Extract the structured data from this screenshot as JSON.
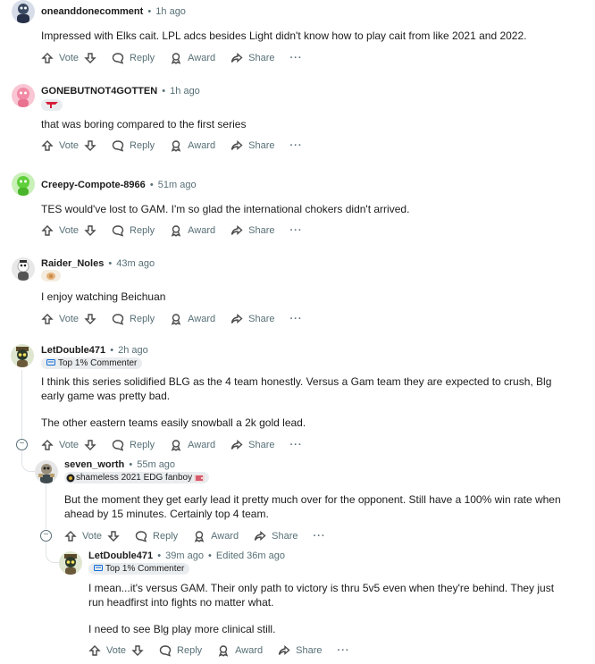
{
  "comments": [
    {
      "author": "oneanddonecomment",
      "time": "1h ago",
      "flair": "",
      "text": [
        "Impressed with Elks cait. LPL adcs besides Light didn't know how to play cait from like 2021 and 2022."
      ]
    },
    {
      "author": "GONEBUTNOT4GOTTEN",
      "time": "1h ago",
      "flair": "",
      "text": [
        "that was boring compared to the first series"
      ]
    },
    {
      "author": "Creepy-Compote-8966",
      "time": "51m ago",
      "flair": "",
      "text": [
        "TES would've lost to GAM. I'm so glad the international chokers didn't arrived."
      ]
    },
    {
      "author": "Raider_Noles",
      "time": "43m ago",
      "flair": "",
      "text": [
        "I enjoy watching Beichuan"
      ]
    },
    {
      "author": "LetDouble471",
      "time": "2h ago",
      "flair": "Top 1% Commenter",
      "text": [
        "I think this series solidified BLG as the 4 team honestly. Versus a Gam team they are expected to crush, Blg early game was pretty bad.",
        "The other eastern teams easily snowball a 2k gold lead."
      ]
    },
    {
      "author": "seven_worth",
      "time": "55m ago",
      "flair": "shameless 2021 EDG fanboy",
      "text": [
        "But the moment they get early lead it pretty much over for the opponent. Still have a 100% win rate when ahead by 15 minutes. Certainly top 4 team."
      ]
    },
    {
      "author": "LetDouble471",
      "time": "39m ago",
      "edited": "Edited 36m ago",
      "flair": "Top 1% Commenter",
      "text": [
        "I mean...it's versus GAM. Their only path to victory is thru 5v5 even when they're behind. They just run headfirst into fights no matter what.",
        "I need to see Blg play more clinical still."
      ]
    }
  ],
  "actions": {
    "vote": "Vote",
    "reply": "Reply",
    "award": "Award",
    "share": "Share",
    "more": "···"
  },
  "colors": {
    "meta": "#576f76",
    "flair_bg": "#eaedef",
    "thread": "#dfe3e6"
  }
}
